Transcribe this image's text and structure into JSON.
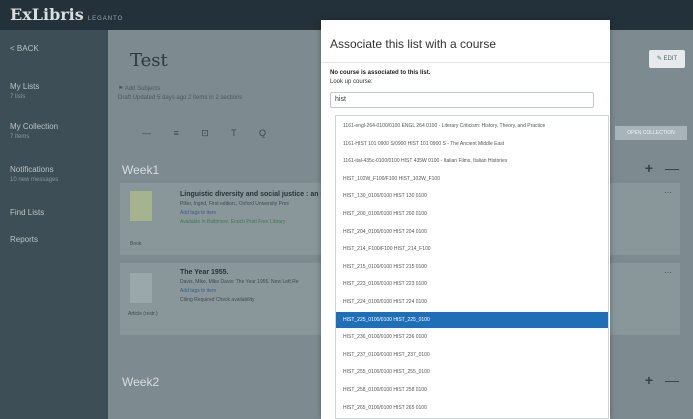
{
  "app": {
    "logo": "ExLibris",
    "logo_sub": "LEGANTO"
  },
  "sidebar": {
    "back": "< BACK",
    "items": [
      {
        "label": "My Lists",
        "sub": "7 lists"
      },
      {
        "label": "My Collection",
        "sub": "7 items"
      },
      {
        "label": "Notifications",
        "sub": "10 new messages"
      },
      {
        "label": "Find Lists",
        "sub": ""
      },
      {
        "label": "Reports",
        "sub": ""
      }
    ]
  },
  "main": {
    "title": "Test",
    "edit": "EDIT",
    "add_subject": "Add Subjects",
    "meta": "Draft  Updated 5 days ago  2 items in 2 sections",
    "toolbar": "— ≡ ⊡ T Q",
    "open_collection": "OPEN COLLECTION",
    "week1": "Week1",
    "week2": "Week2",
    "card1": {
      "title": "Linguistic diversity and social justice : an intr",
      "line1": "Piller, Ingrid, First edition., Oxford University Pres",
      "link": "Add tags to item",
      "status": "Available in Baltimore, Enoch Pratt Free Library",
      "type": "Book"
    },
    "card2": {
      "title": "The Year 1955.",
      "line1": "Davis, Mike, Mike Davis: The Year 1955, New Left Re",
      "link": "Add tags to item",
      "status": "Citing Required   Check availability",
      "type": "Article (restr.)"
    }
  },
  "modal": {
    "title": "Associate this list with a course",
    "no_course": "No course is associated to this list.",
    "lookup_label": "Look up course:",
    "input_value": "hist",
    "options": [
      "1161-engl-264-0100/0100 ENGL 264 0100 - Literary Criticism: History, Theory, and Practice",
      "1161-HIST 101 0900 S/0900 HIST 101 0900 S - The Ancient Middle East",
      "1161-ital-435c-0100/0100 HIST 435W 0100 - Italian Films, Italian Histories",
      "HIST_102W_F100/F100 HIST_102W_F100",
      "HIST_130_0100/0100 HIST 130 0100",
      "HIST_200_0100/0100 HIST 200 0100",
      "HIST_204_0100/0100 HIST 204 0100",
      "HIST_214_F100/F100 HIST_214_F100",
      "HIST_215_0100/0100 HIST 215 0100",
      "HIST_223_0100/0100 HIST 223 0100",
      "HIST_224_0100/0100 HIST 224 0100",
      "HIST_225_0100/0100 HIST_225_0100",
      "HIST_236_0100/0100 HIST 236 0100",
      "HIST_237_0100/0100 HIST_237_0100",
      "HIST_255_0100/0100 HIST_255_0100",
      "HIST_258_0100/0100 HIST 258 0100",
      "HIST_265_0100/0100 HIST 265 0100"
    ],
    "active_index": 11
  },
  "colors": {
    "topbar": "#23323a",
    "sidebar": "#3e4e56",
    "accent": "#1f6fb8"
  }
}
